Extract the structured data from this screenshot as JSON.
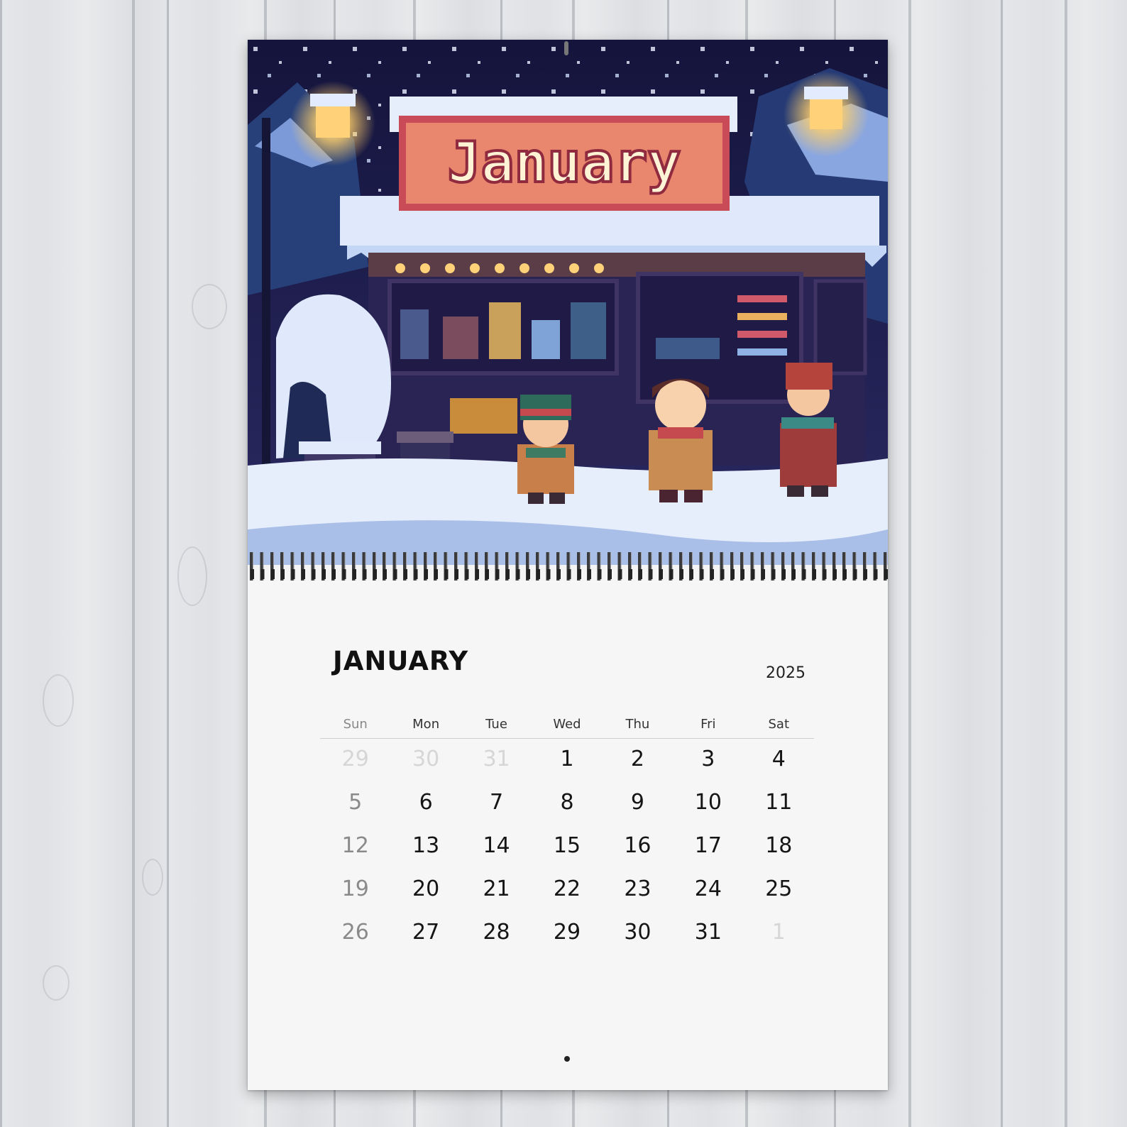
{
  "illustration": {
    "sign_text": "January"
  },
  "calendar": {
    "month": "JANUARY",
    "year": "2025",
    "weekdays": [
      "Sun",
      "Mon",
      "Tue",
      "Wed",
      "Thu",
      "Fri",
      "Sat"
    ],
    "weeks": [
      [
        "29",
        "30",
        "31",
        "1",
        "2",
        "3",
        "4"
      ],
      [
        "5",
        "6",
        "7",
        "8",
        "9",
        "10",
        "11"
      ],
      [
        "12",
        "13",
        "14",
        "15",
        "16",
        "17",
        "18"
      ],
      [
        "19",
        "20",
        "21",
        "22",
        "23",
        "24",
        "25"
      ],
      [
        "26",
        "27",
        "28",
        "29",
        "30",
        "31",
        "1"
      ]
    ],
    "muted_cells": [
      [
        0,
        0
      ],
      [
        0,
        1
      ],
      [
        0,
        2
      ],
      [
        4,
        6
      ]
    ]
  },
  "colors": {
    "night_sky": "#1c1c4e",
    "sign_fill": "#e8866e",
    "sign_border": "#c94b57",
    "lamp_glow": "#ffd27a",
    "snow": "#dfe9fb"
  }
}
